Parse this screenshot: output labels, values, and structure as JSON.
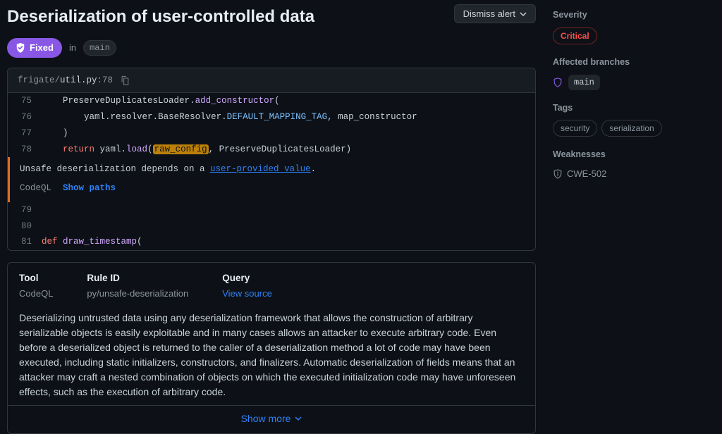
{
  "header": {
    "title": "Deserialization of user-controlled data",
    "dismiss_label": "Dismiss alert"
  },
  "status": {
    "badge": "Fixed",
    "in_label": "in",
    "branch": "main"
  },
  "file": {
    "path_prefix": "frigate/",
    "filename": "util.py",
    "line_suffix": ":78"
  },
  "code": {
    "lines": [
      {
        "n": "75",
        "indent": "    ",
        "tokens": [
          {
            "t": "PreserveDuplicatesLoader",
            "c": "plain"
          },
          {
            "t": ".",
            "c": "plain"
          },
          {
            "t": "add_constructor",
            "c": "fn"
          },
          {
            "t": "(",
            "c": "plain"
          }
        ]
      },
      {
        "n": "76",
        "indent": "        ",
        "tokens": [
          {
            "t": "yaml",
            "c": "plain"
          },
          {
            "t": ".",
            "c": "plain"
          },
          {
            "t": "resolver",
            "c": "plain"
          },
          {
            "t": ".",
            "c": "plain"
          },
          {
            "t": "BaseResolver",
            "c": "plain"
          },
          {
            "t": ".",
            "c": "plain"
          },
          {
            "t": "DEFAULT_MAPPING_TAG",
            "c": "cn"
          },
          {
            "t": ", map_constructor",
            "c": "plain"
          }
        ]
      },
      {
        "n": "77",
        "indent": "    ",
        "tokens": [
          {
            "t": ")",
            "c": "plain"
          }
        ]
      },
      {
        "n": "78",
        "indent": "    ",
        "tokens": [
          {
            "t": "return",
            "c": "kw"
          },
          {
            "t": " yaml.",
            "c": "plain"
          },
          {
            "t": "load",
            "c": "fn"
          },
          {
            "t": "(",
            "c": "plain"
          },
          {
            "t": "raw_config",
            "c": "hl"
          },
          {
            "t": ", PreserveDuplicatesLoader)",
            "c": "plain"
          }
        ]
      }
    ],
    "lines_after": [
      {
        "n": "79",
        "indent": "",
        "tokens": []
      },
      {
        "n": "80",
        "indent": "",
        "tokens": []
      },
      {
        "n": "81",
        "indent": "",
        "tokens": [
          {
            "t": "def",
            "c": "kw"
          },
          {
            "t": " ",
            "c": "plain"
          },
          {
            "t": "draw_timestamp",
            "c": "fn"
          },
          {
            "t": "(",
            "c": "plain"
          }
        ]
      }
    ]
  },
  "alert": {
    "message_prefix": "Unsafe deserialization depends on a ",
    "message_link": "user-provided value",
    "message_suffix": ".",
    "tool": "CodeQL",
    "show_paths": "Show paths"
  },
  "info": {
    "tool_label": "Tool",
    "tool_value": "CodeQL",
    "rule_label": "Rule ID",
    "rule_value": "py/unsafe-deserialization",
    "query_label": "Query",
    "query_link": "View source",
    "description": "Deserializing untrusted data using any deserialization framework that allows the construction of arbitrary serializable objects is easily exploitable and in many cases allows an attacker to execute arbitrary code. Even before a deserialized object is returned to the caller of a deserialization method a lot of code may have been executed, including static initializers, constructors, and finalizers. Automatic deserialization of fields means that an attacker may craft a nested combination of objects on which the executed initialization code may have unforeseen effects, such as the execution of arbitrary code.",
    "show_more": "Show more"
  },
  "sidebar": {
    "severity_label": "Severity",
    "severity_value": "Critical",
    "branches_label": "Affected branches",
    "branches": [
      "main"
    ],
    "tags_label": "Tags",
    "tags": [
      "security",
      "serialization"
    ],
    "weaknesses_label": "Weaknesses",
    "weaknesses": [
      "CWE-502"
    ]
  }
}
